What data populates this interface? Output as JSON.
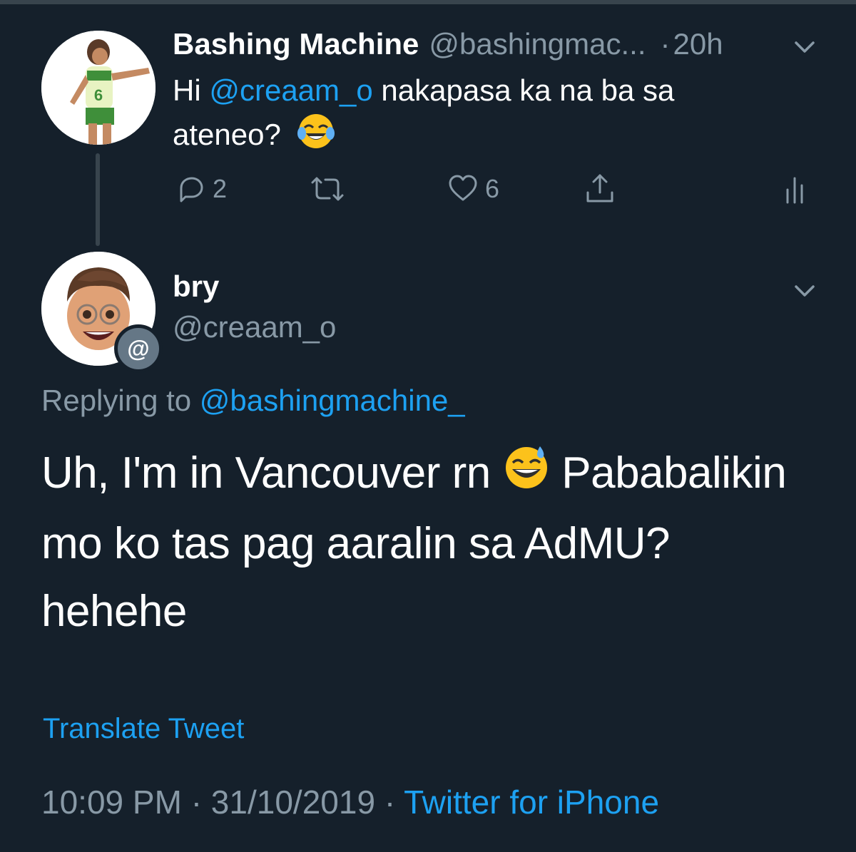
{
  "parent_tweet": {
    "display_name": "Bashing Machine",
    "handle": "@bashingmac...",
    "time": "20h",
    "separator": "·",
    "text_before": "Hi ",
    "mention": "@creaam_o",
    "text_line1_after": " nakapasa ka na ba sa",
    "text_line2": "ateneo?",
    "emoji": "face-with-tears-of-joy",
    "reply_count": "2",
    "retweet_count": "",
    "like_count": "6"
  },
  "reply_tweet": {
    "display_name": "bry",
    "handle": "@creaam_o",
    "badge": "@",
    "replying_to_label": "Replying to ",
    "replying_to_handle": "@bashingmachine_",
    "line1_a": "Uh, I'm in Vancouver rn ",
    "emoji": "grinning-face-with-sweat",
    "line1_b": " Pababalikin",
    "line2": "mo ko tas pag aaralin sa AdMU?",
    "line3": "hehehe",
    "translate_label": "Translate Tweet",
    "time": "10:09 PM",
    "date": "31/10/2019",
    "separator": "·",
    "source": "Twitter for iPhone"
  },
  "colors": {
    "background": "#15202b",
    "text": "#ffffff",
    "muted": "#8899a6",
    "accent": "#1da1f2"
  }
}
